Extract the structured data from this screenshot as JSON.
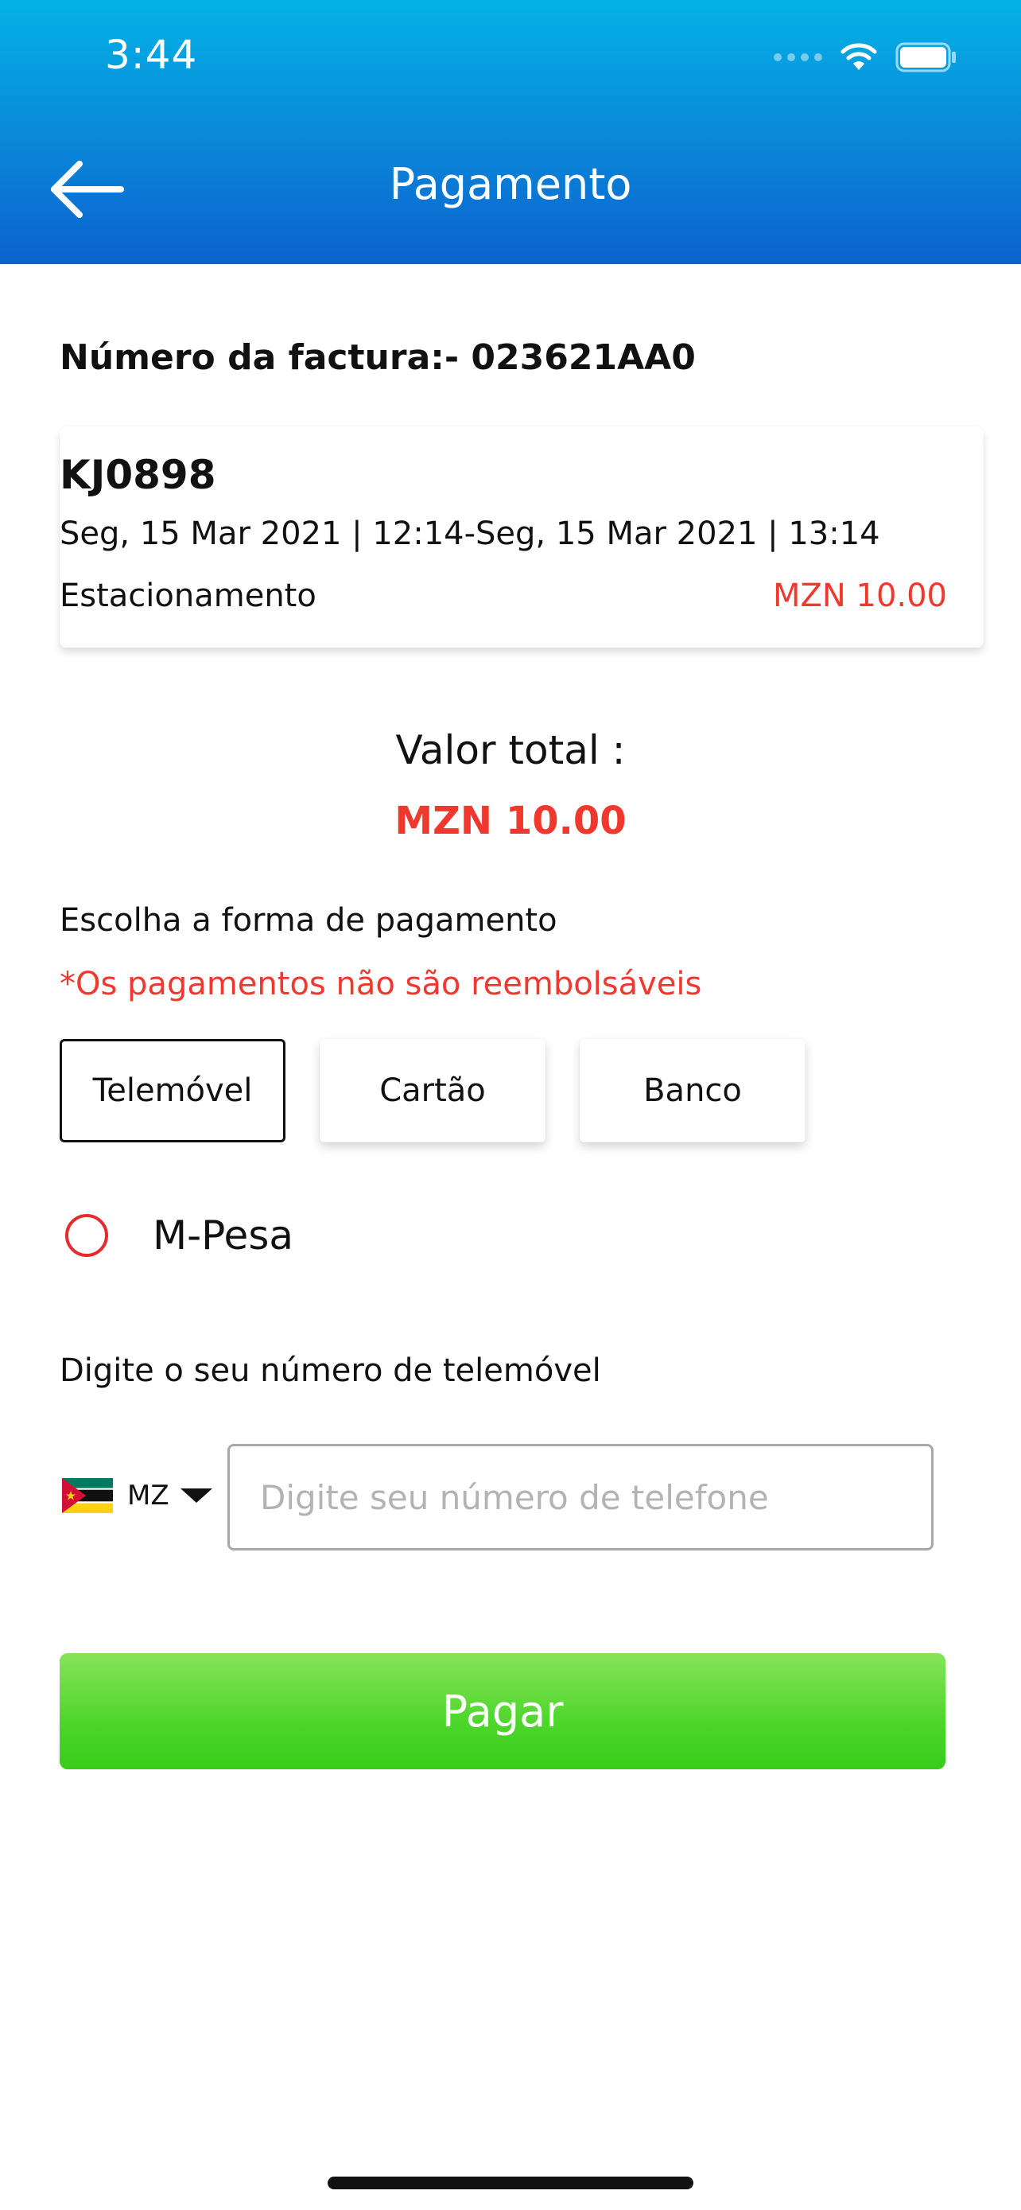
{
  "status_bar": {
    "time": "3:44"
  },
  "header": {
    "title": "Pagamento",
    "background_colors": [
      "#04b2e6",
      "#0b62cf"
    ]
  },
  "invoice": {
    "label": "Número da factura:- 023621AA0"
  },
  "booking": {
    "plate": "KJ0898",
    "dates": "Seg, 15 Mar 2021 | 12:14-Seg, 15 Mar 2021 | 13:14",
    "service": "Estacionamento",
    "price": "MZN 10.00"
  },
  "total": {
    "label": "Valor total :",
    "value": "MZN 10.00"
  },
  "payment": {
    "choose_label": "Escolha a forma de pagamento",
    "refund_note": "*Os pagamentos não são reembolsáveis",
    "methods": [
      {
        "label": "Telemóvel",
        "selected": true
      },
      {
        "label": "Cartão",
        "selected": false
      },
      {
        "label": "Banco",
        "selected": false
      }
    ],
    "provider_option": {
      "label": "M-Pesa",
      "checked": false
    }
  },
  "phone": {
    "label": "Digite o seu número de telemóvel",
    "country_code": "MZ",
    "flag_icon": "mozambique-flag-icon",
    "input_value": "",
    "placeholder": "Digite seu número de telefone"
  },
  "actions": {
    "pay_label": "Pagar",
    "pay_color": "#4ed62b"
  },
  "colors": {
    "accent_red": "#f0382f"
  }
}
